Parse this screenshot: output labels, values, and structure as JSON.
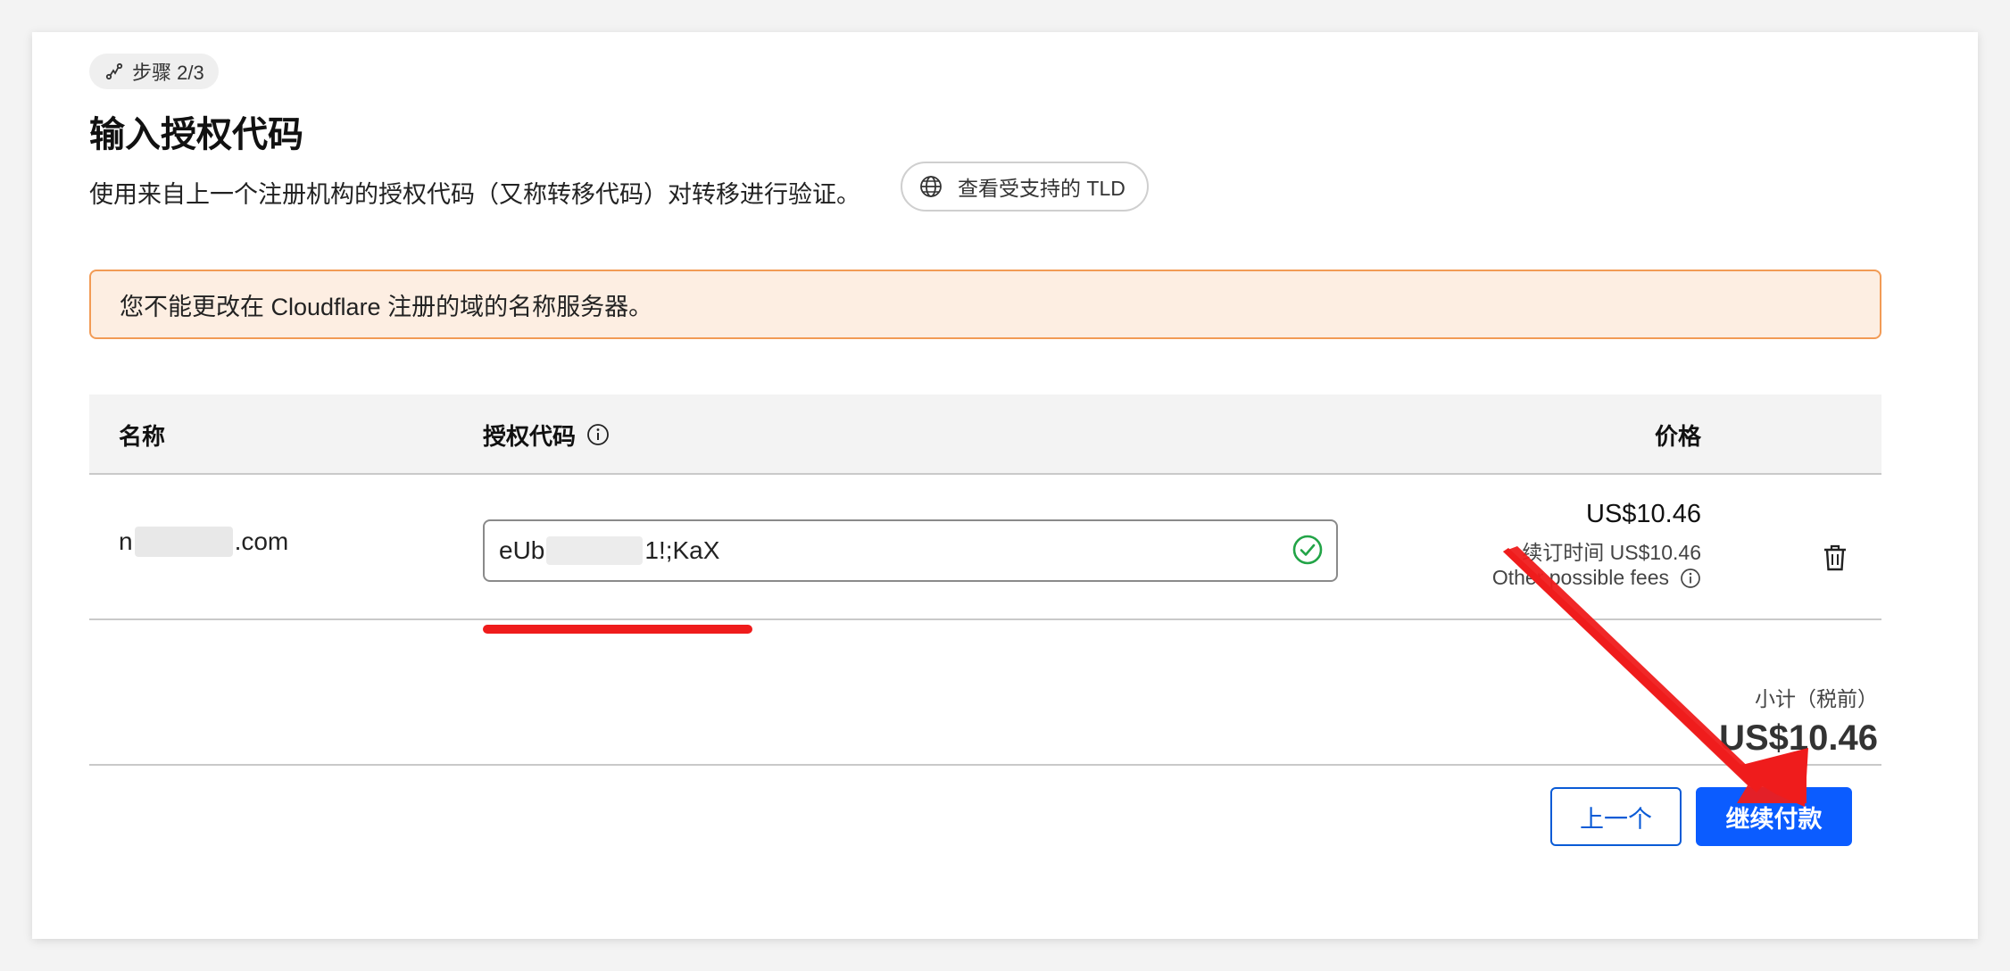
{
  "step": {
    "label": "步骤 2/3"
  },
  "title": "输入授权代码",
  "description": "使用来自上一个注册机构的授权代码（又称转移代码）对转移进行验证。",
  "tld_button": {
    "label": "查看受支持的 TLD",
    "icon": "globe-icon"
  },
  "alert": {
    "text": "您不能更改在 Cloudflare 注册的域的名称服务器。"
  },
  "table": {
    "headers": {
      "name": "名称",
      "auth_code": "授权代码",
      "price": "价格"
    },
    "rows": [
      {
        "domain_prefix": "n",
        "domain_suffix": ".com",
        "auth_code_prefix": "eUb",
        "auth_code_suffix": "1!;KaX",
        "price": "US$10.46",
        "renewal": "续订时间 US$10.46",
        "other_fees": "Other possible fees"
      }
    ]
  },
  "subtotal": {
    "label": "小计（税前）",
    "value": "US$10.46"
  },
  "buttons": {
    "previous": "上一个",
    "continue": "继续付款"
  },
  "colors": {
    "primary": "#0b5cff",
    "alert_bg": "#fdeee2",
    "alert_border": "#f29b55",
    "success": "#22a447",
    "annotation": "#ef1c1c"
  }
}
